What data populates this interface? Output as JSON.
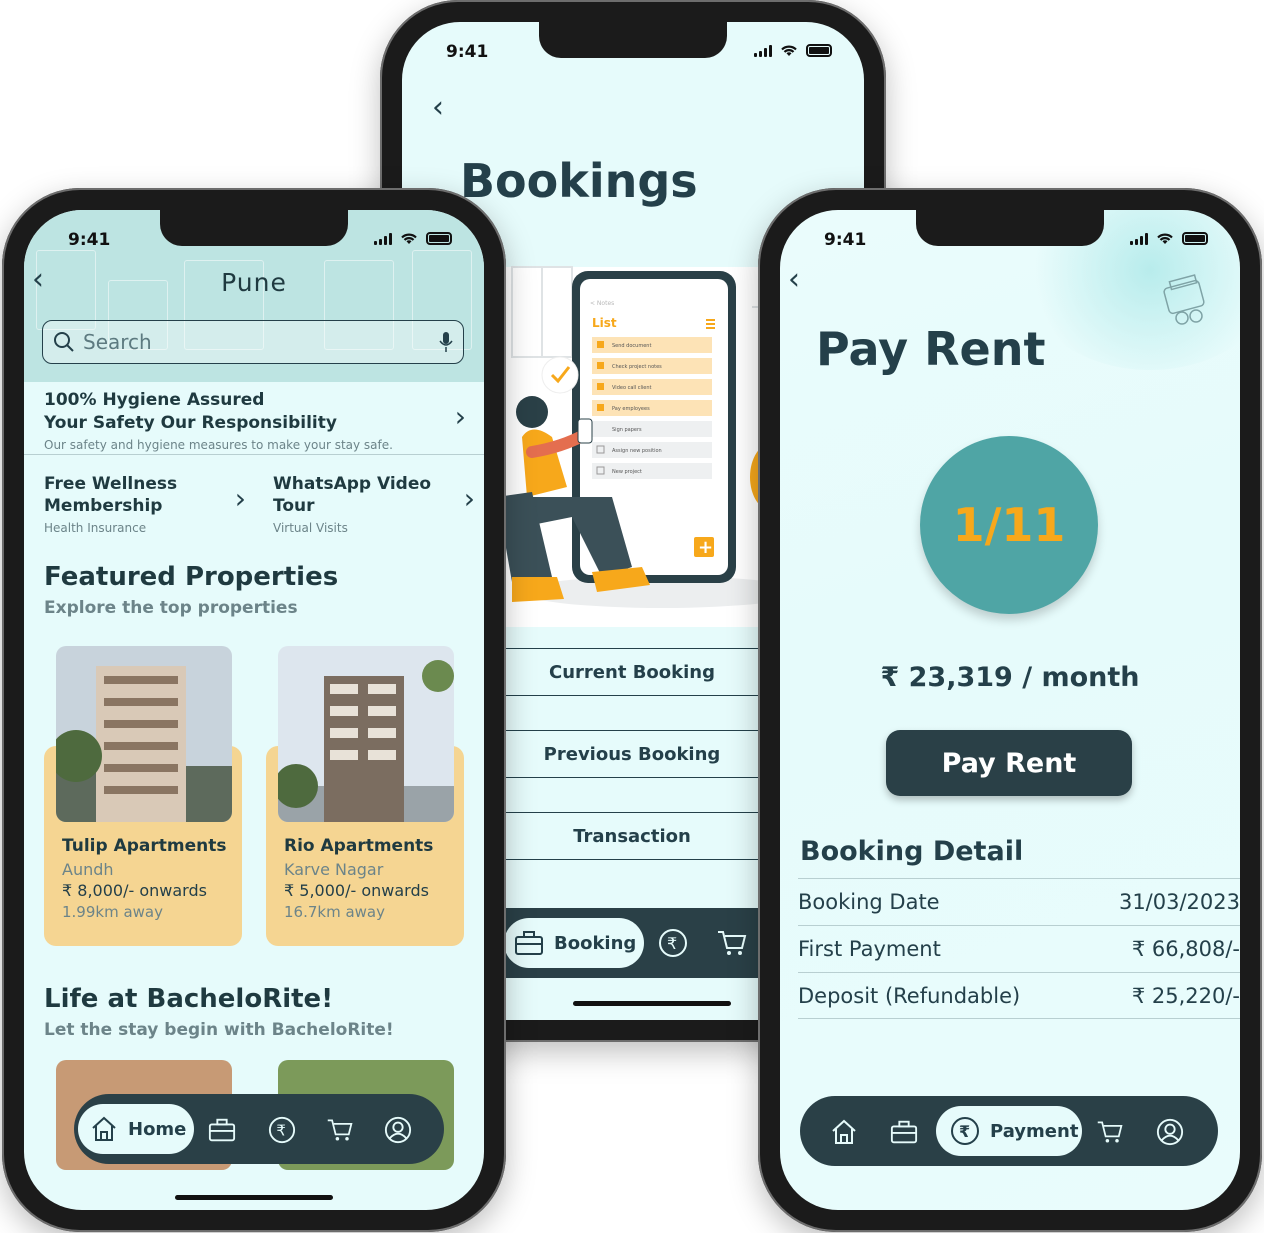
{
  "status": {
    "time": "9:41"
  },
  "home": {
    "city": "Pune",
    "search_placeholder": "Search",
    "hygiene": {
      "line1": "100% Hygiene Assured",
      "line2": "Your Safety Our Responsibility",
      "sub": "Our safety and hygiene measures to make your stay safe."
    },
    "promos": [
      {
        "title1": "Free Wellness",
        "title2": "Membership",
        "sub": "Health Insurance"
      },
      {
        "title1": "WhatsApp Video",
        "title2": "Tour",
        "sub": "Virtual Visits"
      }
    ],
    "featured": {
      "title": "Featured Properties",
      "subtitle": "Explore the top properties"
    },
    "properties": [
      {
        "name": "Tulip Apartments",
        "area": "Aundh",
        "price": "₹ 8,000/- onwards",
        "distance": "1.99km away"
      },
      {
        "name": "Rio Apartments",
        "area": "Karve Nagar",
        "price": "₹ 5,000/- onwards",
        "distance": "16.7km away"
      }
    ],
    "life": {
      "title": "Life at BacheloRite!",
      "subtitle": "Let the stay begin with BacheloRite!"
    },
    "nav_active": "Home"
  },
  "bookings": {
    "title": "Bookings",
    "illustration": {
      "header": "List",
      "back": "< Notes",
      "items": [
        "Send document",
        "Check project notes",
        "Video call client",
        "Pay employees",
        "Sign papers",
        "Assign new position",
        "New project"
      ]
    },
    "options": [
      "Current Booking",
      "Previous Booking",
      "Transaction"
    ],
    "nav_active": "Booking"
  },
  "pay": {
    "title": "Pay Rent",
    "progress": "1/11",
    "amount": "₹ 23,319 / month",
    "button": "Pay Rent",
    "detail_title": "Booking Detail",
    "details": [
      {
        "label": "Booking Date",
        "value": "31/03/2023"
      },
      {
        "label": "First Payment",
        "value": "₹ 66,808/-"
      },
      {
        "label": "Deposit (Refundable)",
        "value": "₹ 25,220/-"
      }
    ],
    "nav_active": "Payment"
  },
  "colors": {
    "dark": "#2a4047",
    "accent": "#f7a81b",
    "bg": "#e6fbfb",
    "teal": "#4fa5a5",
    "card": "#f5d592"
  }
}
